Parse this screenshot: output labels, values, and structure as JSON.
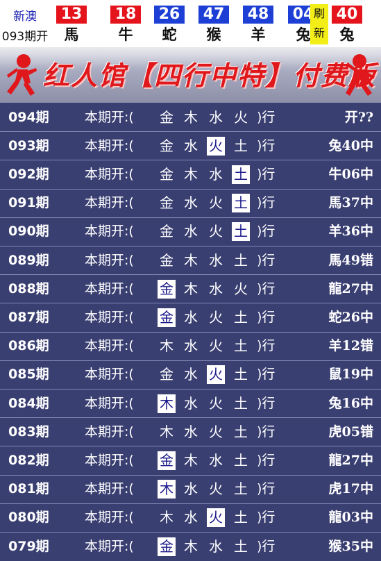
{
  "header": {
    "label_top": "新澳",
    "label_bottom": "093期开",
    "balls": [
      {
        "number": "13",
        "zodiac": "馬",
        "color": "#e5141c"
      },
      {
        "number": "18",
        "zodiac": "牛",
        "color": "#e5141c"
      },
      {
        "number": "26",
        "zodiac": "蛇",
        "color": "#1d3fd6"
      },
      {
        "number": "47",
        "zodiac": "猴",
        "color": "#1d3fd6"
      },
      {
        "number": "48",
        "zodiac": "羊",
        "color": "#1d3fd6"
      },
      {
        "number": "04",
        "zodiac": "兔",
        "color": "#1d3fd6"
      }
    ],
    "refresh_top": "刷",
    "refresh_bottom": "新",
    "special": {
      "number": "40",
      "zodiac": "兔",
      "color": "#e5141c"
    }
  },
  "banner": {
    "title": "红人馆【四行中特】付费版"
  },
  "row_label": "本期开:(",
  "row_close": ")行",
  "rows": [
    {
      "period": "094期",
      "elements": [
        "金",
        "木",
        "水",
        "火"
      ],
      "highlight": [],
      "result": "开??"
    },
    {
      "period": "093期",
      "elements": [
        "金",
        "水",
        "火",
        "土"
      ],
      "highlight": [
        2
      ],
      "result": "兔40中"
    },
    {
      "period": "092期",
      "elements": [
        "金",
        "木",
        "水",
        "土"
      ],
      "highlight": [
        3
      ],
      "result": "牛06中"
    },
    {
      "period": "091期",
      "elements": [
        "金",
        "水",
        "火",
        "土"
      ],
      "highlight": [
        3
      ],
      "result": "馬37中"
    },
    {
      "period": "090期",
      "elements": [
        "金",
        "水",
        "火",
        "土"
      ],
      "highlight": [
        3
      ],
      "result": "羊36中"
    },
    {
      "period": "089期",
      "elements": [
        "金",
        "木",
        "水",
        "土"
      ],
      "highlight": [],
      "result": "馬49错"
    },
    {
      "period": "088期",
      "elements": [
        "金",
        "木",
        "水",
        "火"
      ],
      "highlight": [
        0
      ],
      "result": "龍27中"
    },
    {
      "period": "087期",
      "elements": [
        "金",
        "水",
        "火",
        "土"
      ],
      "highlight": [
        0
      ],
      "result": "蛇26中"
    },
    {
      "period": "086期",
      "elements": [
        "木",
        "水",
        "火",
        "土"
      ],
      "highlight": [],
      "result": "羊12错"
    },
    {
      "period": "085期",
      "elements": [
        "金",
        "水",
        "火",
        "土"
      ],
      "highlight": [
        2
      ],
      "result": "鼠19中"
    },
    {
      "period": "084期",
      "elements": [
        "木",
        "水",
        "火",
        "土"
      ],
      "highlight": [
        0
      ],
      "result": "兔16中"
    },
    {
      "period": "083期",
      "elements": [
        "木",
        "水",
        "火",
        "土"
      ],
      "highlight": [],
      "result": "虎05错"
    },
    {
      "period": "082期",
      "elements": [
        "金",
        "木",
        "水",
        "土"
      ],
      "highlight": [
        0
      ],
      "result": "龍27中"
    },
    {
      "period": "081期",
      "elements": [
        "木",
        "水",
        "火",
        "土"
      ],
      "highlight": [
        0
      ],
      "result": "虎17中"
    },
    {
      "period": "080期",
      "elements": [
        "木",
        "水",
        "火",
        "土"
      ],
      "highlight": [
        2
      ],
      "result": "龍03中"
    },
    {
      "period": "079期",
      "elements": [
        "金",
        "木",
        "水",
        "土"
      ],
      "highlight": [
        0
      ],
      "result": "猴35中"
    }
  ]
}
